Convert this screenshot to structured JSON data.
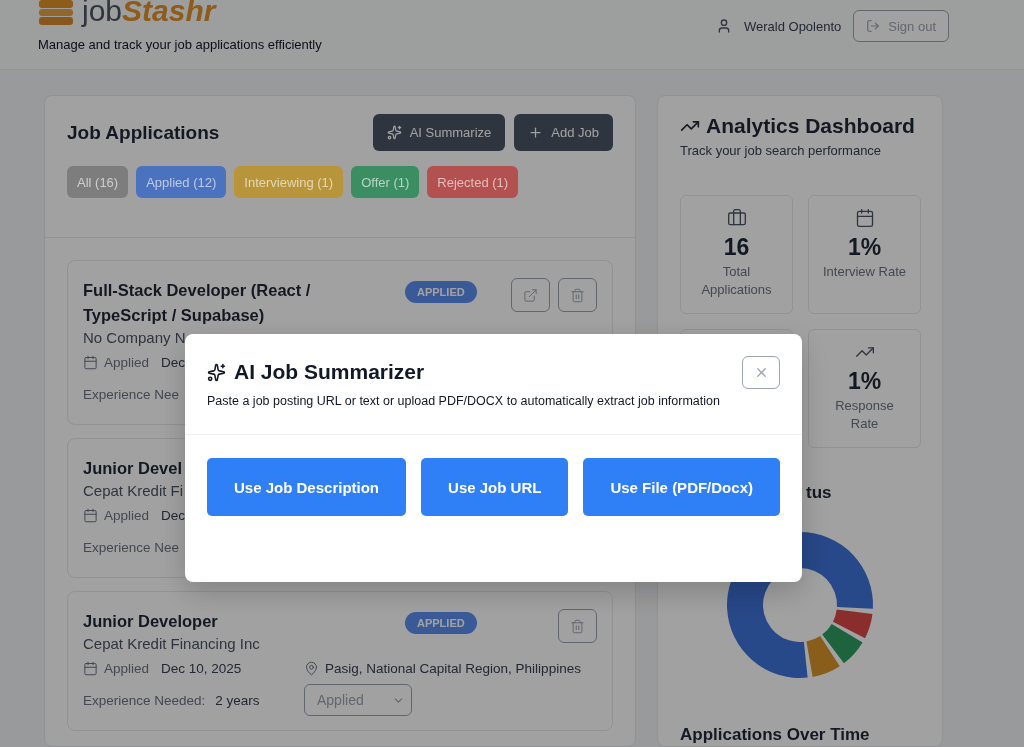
{
  "header": {
    "logo_prefix": "job",
    "logo_accent": "Stashr",
    "tagline": "Manage and track your job applications efficiently",
    "user": "Werald Opolento",
    "sign_out": "Sign out"
  },
  "jobs_panel": {
    "title": "Job Applications",
    "actions": [
      {
        "kind": "summarize",
        "label": "AI Summarize"
      },
      {
        "kind": "add",
        "label": "Add Job"
      }
    ],
    "filters": [
      {
        "label": "All (16)",
        "color": "#7d7d7d"
      },
      {
        "label": "Applied (12)",
        "color": "#4a72be"
      },
      {
        "label": "Interviewing (1)",
        "color": "#b8953a"
      },
      {
        "label": "Offer (1)",
        "color": "#3b8e62"
      },
      {
        "label": "Rejected (1)",
        "color": "#b35050"
      }
    ],
    "cards": [
      {
        "title": "Full-Stack Developer (React / TypeScript / Supabase)",
        "company": "No Company N",
        "applied_label": "Applied",
        "date": "Dec",
        "experience_label": "Experience Nee",
        "badge": "APPLIED",
        "tools": [
          {
            "kind": "open"
          },
          {
            "kind": "delete"
          }
        ]
      },
      {
        "title": "Junior Devel",
        "company": "Cepat Kredit Fi",
        "applied_label": "Applied",
        "date": "Dec",
        "experience_label": "Experience Nee"
      },
      {
        "title": "Junior Developer",
        "company": "Cepat Kredit Financing Inc",
        "applied_label": "Applied",
        "date": "Dec 10, 2025",
        "location": "Pasig, National Capital Region, Philippines",
        "experience_label": "Experience Needed:",
        "experience": "2 years",
        "badge": "APPLIED",
        "has_status_select": true,
        "status_value": "Applied",
        "tools": [
          {
            "kind": "delete"
          }
        ]
      }
    ]
  },
  "analytics": {
    "title": "Analytics Dashboard",
    "subtitle": "Track your job search performance",
    "stats": [
      {
        "kind": "briefcase",
        "value": "16",
        "label": "Total Applications"
      },
      {
        "kind": "calendar",
        "value": "1%",
        "label": "Interview Rate"
      },
      {
        "kind": "trend",
        "value": "1%",
        "label": "Response Rate"
      }
    ],
    "status_heading": "tus",
    "over_time_heading": "Applications Over Time"
  },
  "modal": {
    "title": "AI Job Summarizer",
    "subtitle": "Paste a job posting URL or text or upload PDF/DOCX to automatically extract job information",
    "options": [
      "Use Job Description",
      "Use Job URL",
      "Use File (PDF/Docx)"
    ]
  }
}
